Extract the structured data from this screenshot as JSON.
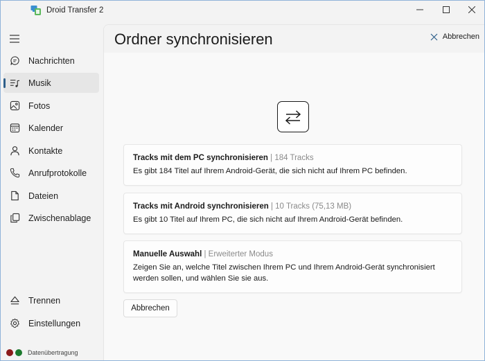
{
  "window": {
    "title": "Droid Transfer 2",
    "controls": [
      "minimize-icon",
      "maximize-icon",
      "close-icon"
    ]
  },
  "sidebar": {
    "menu_icon": "hamburger-icon",
    "items": [
      {
        "label": "Nachrichten",
        "icon": "chat-bubble-icon",
        "active": false
      },
      {
        "label": "Musik",
        "icon": "music-list-icon",
        "active": true
      },
      {
        "label": "Fotos",
        "icon": "photo-icon",
        "active": false
      },
      {
        "label": "Kalender",
        "icon": "calendar-icon",
        "active": false
      },
      {
        "label": "Kontakte",
        "icon": "person-icon",
        "active": false
      },
      {
        "label": "Anrufprotokolle",
        "icon": "phone-icon",
        "active": false
      },
      {
        "label": "Dateien",
        "icon": "file-icon",
        "active": false
      },
      {
        "label": "Zwischenablage",
        "icon": "clipboard-icon",
        "active": false
      }
    ],
    "bottom_items": [
      {
        "label": "Trennen",
        "icon": "eject-icon"
      },
      {
        "label": "Einstellungen",
        "icon": "gear-icon"
      }
    ],
    "status": {
      "text": "Datenübertragung",
      "colors": [
        "#8b1a1a",
        "#1d7a2e"
      ]
    }
  },
  "main": {
    "title": "Ordner synchronisieren",
    "header_cancel": "Abbrechen",
    "sync_icon": "sync-arrows-icon",
    "options": [
      {
        "title": "Tracks mit dem PC synchronisieren",
        "sub": " | 184 Tracks",
        "desc": "Es gibt 184 Titel auf Ihrem Android-Gerät, die sich nicht auf Ihrem PC befinden."
      },
      {
        "title": "Tracks mit Android synchronisieren",
        "sub": " | 10 Tracks (75,13 MB)",
        "desc": "Es gibt 10 Titel auf Ihrem PC, die sich nicht auf Ihrem Android-Gerät befinden."
      },
      {
        "title": "Manuelle Auswahl",
        "sub": " | Erweiterter Modus",
        "desc": "Zeigen Sie an, welche Titel zwischen Ihrem PC und Ihrem Android-Gerät synchronisiert werden sollen, und wählen Sie sie aus."
      }
    ],
    "footer_cancel": "Abbrechen"
  },
  "colors": {
    "accent": "#2f5f8a",
    "background": "#f3f3f3",
    "content": "#f9f9f9"
  }
}
